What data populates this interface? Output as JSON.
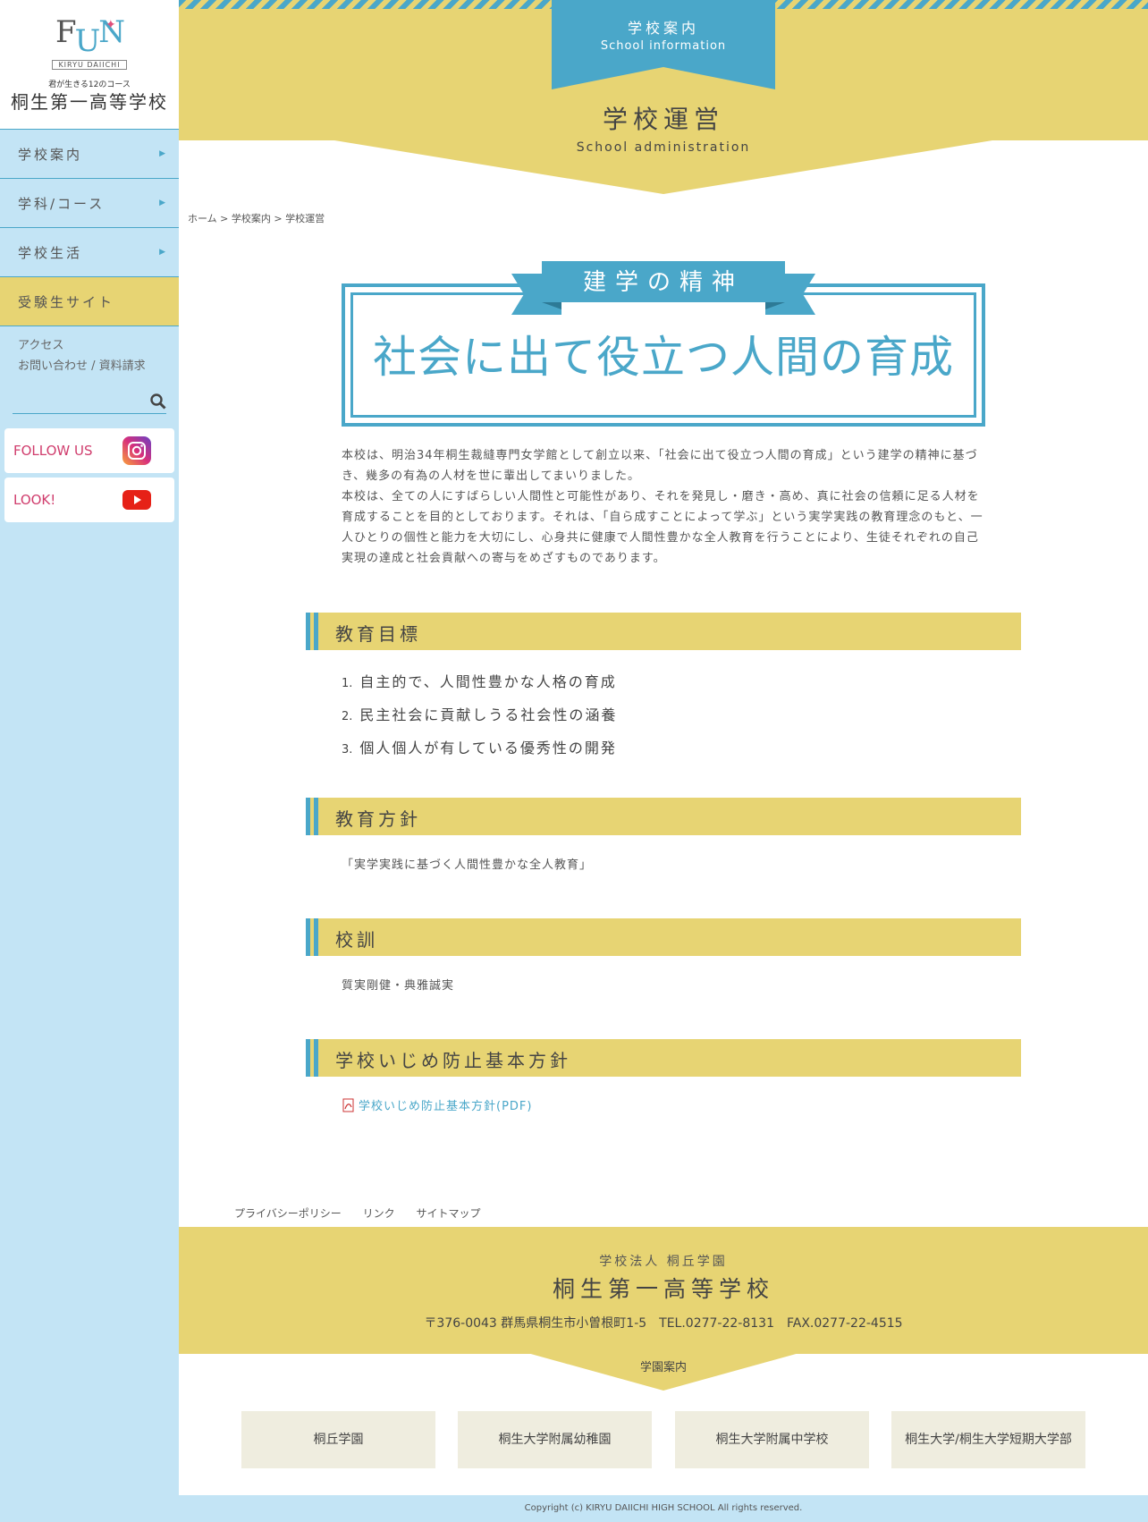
{
  "sidebar": {
    "logo_tagline": "君が生きる12のコース",
    "logo_kiryu": "KIRYU DAIICHI",
    "school_name": "桐生第一高等学校",
    "nav": [
      {
        "label": "学校案内"
      },
      {
        "label": "学科/コース"
      },
      {
        "label": "学校生活"
      },
      {
        "label": "受験生サイト"
      }
    ],
    "links": [
      "アクセス",
      "お問い合わせ / 資料請求"
    ],
    "search_placeholder": "",
    "social": [
      {
        "label": "FOLLOW US",
        "icon": "instagram-icon"
      },
      {
        "label": "LOOK!",
        "icon": "youtube-icon"
      }
    ]
  },
  "hero": {
    "tab_jp": "学校案内",
    "tab_en": "School information",
    "title": "学校運営",
    "subtitle": "School administration"
  },
  "breadcrumb": "ホーム > 学校案内 > 学校運営",
  "spirit": {
    "label": "建学の精神",
    "main": "社会に出て役立つ人間の育成"
  },
  "intro": [
    "本校は、明治34年桐生裁縫専門女学館として創立以来、「社会に出て役立つ人間の育成」という建学の精神に基づき、幾多の有為の人材を世に輩出してまいりました。",
    "本校は、全ての人にすばらしい人間性と可能性があり、それを発見し・磨き・高め、真に社会の信頼に足る人材を育成することを目的としております。それは、「自ら成すことによって学ぶ」という実学実践の教育理念のもと、一人ひとりの個性と能力を大切にし、心身共に健康で人間性豊かな全人教育を行うことにより、生徒それぞれの自己実現の達成と社会貢献への寄与をめざすものであります。"
  ],
  "sections": {
    "goals_title": "教育目標",
    "goals": [
      {
        "num": "1.",
        "text": "自主的で、人間性豊かな人格の育成"
      },
      {
        "num": "2.",
        "text": "民主社会に貢献しうる社会性の涵養"
      },
      {
        "num": "3.",
        "text": "個人個人が有している優秀性の開発"
      }
    ],
    "policy_title": "教育方針",
    "policy_text": "「実学実践に基づく人間性豊かな全人教育」",
    "motto_title": "校訓",
    "motto_text": "質実剛健・典雅誠実",
    "bullying_title": "学校いじめ防止基本方針",
    "bullying_link": "学校いじめ防止基本方針(PDF)"
  },
  "footer": {
    "links": [
      "プライバシーポリシー",
      "リンク",
      "サイトマップ"
    ],
    "corp": "学校法人 桐丘学園",
    "school": "桐生第一高等学校",
    "address": "〒376-0043 群馬県桐生市小曽根町1-5　TEL.0277-22-8131　FAX.0277-22-4515",
    "group_label": "学園案内",
    "group": [
      "桐丘学園",
      "桐生大学附属幼稚園",
      "桐生大学附属中学校",
      "桐生大学/桐生大学短期大学部"
    ],
    "copyright": "Copyright (c) KIRYU DAIICHI HIGH SCHOOL All rights reserved."
  },
  "colors": {
    "blue": "#4aa7c9",
    "yellow": "#e7d473",
    "light_blue": "#c3e4f5",
    "beige": "#efeddf"
  }
}
